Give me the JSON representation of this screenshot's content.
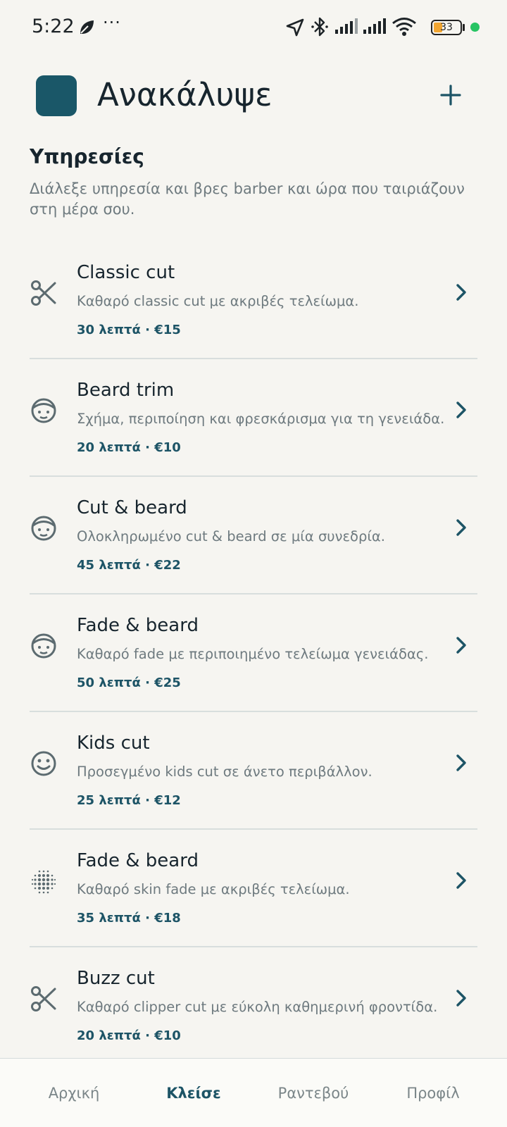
{
  "status_bar": {
    "time": "5:22",
    "more": "···",
    "battery": "33",
    "icons": [
      "leaf-icon",
      "location-arrow-icon",
      "bluetooth-icon",
      "signal-icon",
      "signal-icon",
      "wifi-icon",
      "battery-icon"
    ]
  },
  "header": {
    "title": "Ανακάλυψε",
    "add_icon": "plus-icon"
  },
  "section": {
    "title": "Υπηρεσίες",
    "description": "Διάλεξε υπηρεσία και βρες barber και ώρα που ταιριάζουν στη μέρα σου."
  },
  "services": [
    {
      "icon": "scissors-icon",
      "title": "Classic cut",
      "description": "Καθαρό classic cut με ακριβές τελείωμα.",
      "meta": "30 λεπτά · €15"
    },
    {
      "icon": "face-icon",
      "title": "Beard trim",
      "description": "Σχήμα, περιποίηση και φρεσκάρισμα για τη γενειάδα.",
      "meta": "20 λεπτά · €10"
    },
    {
      "icon": "face-icon",
      "title": "Cut & beard",
      "description": "Ολοκληρωμένο cut & beard σε μία συνεδρία.",
      "meta": "45 λεπτά · €22"
    },
    {
      "icon": "face-icon",
      "title": "Fade & beard",
      "description": "Καθαρό fade με περιποιημένο τελείωμα γενειάδας.",
      "meta": "50 λεπτά · €25"
    },
    {
      "icon": "smile-icon",
      "title": "Kids cut",
      "description": "Προσεγμένο kids cut σε άνετο περιβάλλον.",
      "meta": "25 λεπτά · €12"
    },
    {
      "icon": "dots-grid-icon",
      "title": "Fade & beard",
      "description": "Καθαρό skin fade με ακριβές τελείωμα.",
      "meta": "35 λεπτά · €18"
    },
    {
      "icon": "scissors-icon",
      "title": "Buzz cut",
      "description": "Καθαρό clipper cut με εύκολη καθημερινή φροντίδα.",
      "meta": "20 λεπτά · €10"
    }
  ],
  "bottom_nav": {
    "items": [
      {
        "label": "Αρχική",
        "active": false
      },
      {
        "label": "Κλείσε",
        "active": true
      },
      {
        "label": "Ραντεβού",
        "active": false
      },
      {
        "label": "Προφίλ",
        "active": false
      }
    ]
  },
  "colors": {
    "background": "#f6f5f1",
    "accent": "#1d5466",
    "logo": "#1a5768",
    "text": "#17252e",
    "muted": "#6e7a7f",
    "divider": "#d8dedd"
  }
}
